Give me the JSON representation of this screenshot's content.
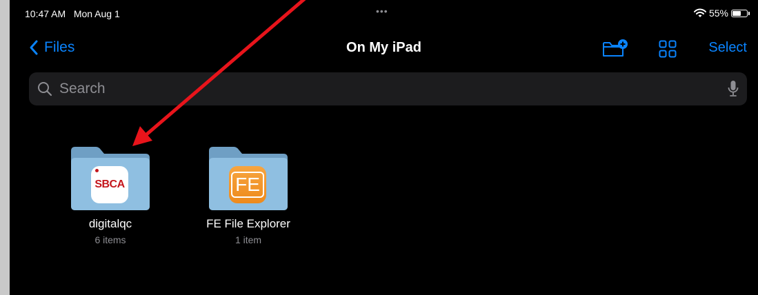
{
  "status_bar": {
    "time": "10:47 AM",
    "date": "Mon Aug 1",
    "multitask_dots": "•••",
    "battery_text": "55%",
    "battery_level": 0.55,
    "wifi_icon": "wifi-icon"
  },
  "nav": {
    "back_label": "Files",
    "title": "On My iPad",
    "select_label": "Select",
    "icons": [
      "chevron-left-icon",
      "new-folder-icon",
      "grid-view-icon"
    ]
  },
  "search": {
    "placeholder": "Search",
    "icons": [
      "magnifier-icon",
      "microphone-icon"
    ]
  },
  "folders": [
    {
      "name": "digitalqc",
      "count": "6 items",
      "app_badge": "SBCA"
    },
    {
      "name": "FE File Explorer",
      "count": "1 item",
      "app_badge": "FE"
    }
  ],
  "colors": {
    "accent": "#0a84ff",
    "background": "#000000",
    "search_field": "#1c1c1e",
    "folder": "#8fbfe1",
    "annotation_arrow": "#e8141b",
    "sbca_red": "#c4161c",
    "fe_orange": "#f29a2e"
  }
}
